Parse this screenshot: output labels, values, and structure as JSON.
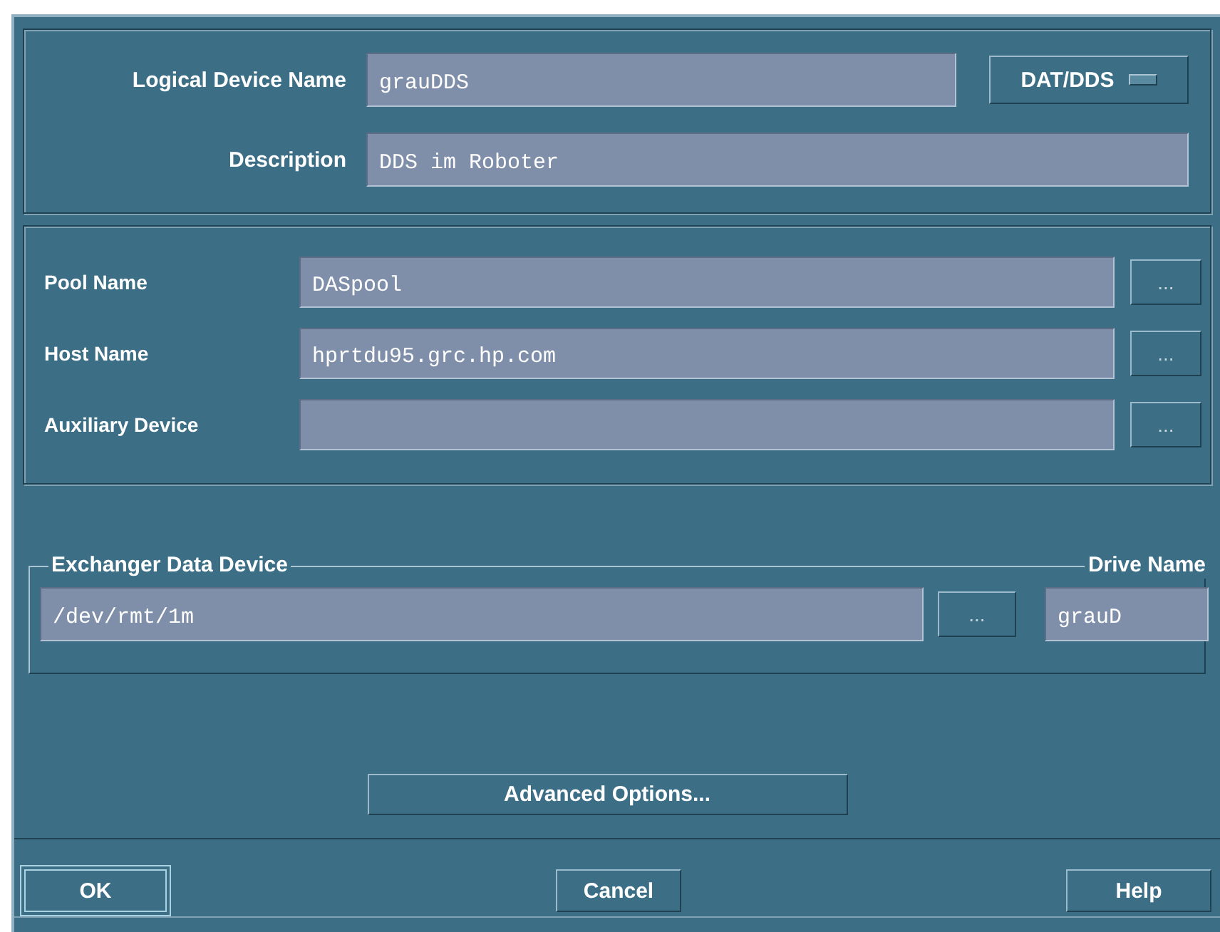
{
  "device": {
    "fields": [
      {
        "label": "Logical Device Name",
        "value": "grauDDS"
      },
      {
        "label": "Description",
        "value": "DDS im Roboter"
      }
    ],
    "media_type": "DAT/DDS"
  },
  "pool": {
    "fields": [
      {
        "label": "Pool Name",
        "value": "DASpool",
        "browse": "..."
      },
      {
        "label": "Host Name",
        "value": "hprtdu95.grc.hp.com",
        "browse": "..."
      },
      {
        "label": "Auxiliary Device",
        "browse": "..."
      }
    ]
  },
  "exchanger": {
    "title": "Exchanger Data Device",
    "value": "/dev/rmt/1m",
    "browse": "...",
    "drive_title": "Drive Name",
    "drive_value": "grauD"
  },
  "advanced_button": "Advanced Options...",
  "buttons": [
    {
      "label": "OK",
      "default": true
    },
    {
      "label": "Cancel",
      "default": false
    },
    {
      "label": "Help",
      "default": false
    }
  ]
}
